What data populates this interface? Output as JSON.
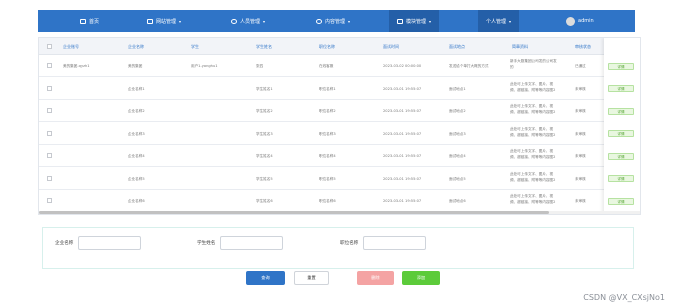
{
  "nav": {
    "home": "首页",
    "site_mgmt": "网站管理",
    "people_mgmt": "人员管理",
    "content_mgmt": "内容管理",
    "module_mgmt": "模块管理",
    "personal_mgmt": "个人管理",
    "user": "admin",
    "caret": "▾"
  },
  "table": {
    "headers": [
      "企业账号",
      "企业名称",
      "学生",
      "学生姓名",
      "职位名称",
      "面试时间",
      "面试地点",
      "简章资料",
      "审核状态",
      "操作"
    ],
    "rows": [
      {
        "account": "美的集团-qyzh1",
        "company": "美的集团",
        "student": "用户1-yonghu1",
        "name": "张四",
        "position": "在线客服",
        "time": "2023-03-02 00:00:00",
        "place": "发送给个单打大概的方式",
        "detail": "新手大厨集团公司发的公司发的",
        "status": "已通过",
        "op": "详情"
      },
      {
        "account": "",
        "company": "企业名称1",
        "student": "",
        "name": "学生姓名1",
        "position": "职位名称1",
        "time": "2023-03-01 19:55:07",
        "place": "面试地点1",
        "detail": "此处可上传文字、图片、视频、超链接、附等等内容图2",
        "status": "未审核",
        "op": "详情"
      },
      {
        "account": "",
        "company": "企业名称2",
        "student": "",
        "name": "学生姓名2",
        "position": "职位名称2",
        "time": "2023-03-01 19:55:07",
        "place": "面试地点2",
        "detail": "此处可上传文字、图片、视频、超链接、附等等内容图2",
        "status": "未审核",
        "op": "详情"
      },
      {
        "account": "",
        "company": "企业名称3",
        "student": "",
        "name": "学生姓名3",
        "position": "职位名称3",
        "time": "2023-03-01 19:55:07",
        "place": "面试地点3",
        "detail": "此处可上传文字、图片、视频、超链接、附等等内容图2",
        "status": "未审核",
        "op": "详情"
      },
      {
        "account": "",
        "company": "企业名称4",
        "student": "",
        "name": "学生姓名4",
        "position": "职位名称4",
        "time": "2023-03-01 19:55:07",
        "place": "面试地点4",
        "detail": "此处可上传文字、图片、视频、超链接、附等等内容图2",
        "status": "未审核",
        "op": "详情"
      },
      {
        "account": "",
        "company": "企业名称5",
        "student": "",
        "name": "学生姓名5",
        "position": "职位名称5",
        "time": "2023-03-01 19:55:07",
        "place": "面试地点5",
        "detail": "此处可上传文字、图片、视频、超链接、附等等内容图2",
        "status": "未审核",
        "op": "详情"
      },
      {
        "account": "",
        "company": "企业名称6",
        "student": "",
        "name": "学生姓名6",
        "position": "职位名称6",
        "time": "2023-03-01 19:55:07",
        "place": "面试地点6",
        "detail": "此处可上传文字、图片、视频、超链接、附等等内容图2",
        "status": "未审核",
        "op": "详情"
      }
    ]
  },
  "search": {
    "company_label": "企业名称",
    "student_label": "学生姓名",
    "position_label": "职位名称",
    "company_value": "",
    "student_value": "",
    "position_value": ""
  },
  "buttons": {
    "query": "查询",
    "reset": "重置",
    "delete": "删除",
    "add": "添加"
  },
  "watermark": "CSDN @VX_CXsjNo1",
  "colors": {
    "nav_bg": "#2f74c7",
    "header_text": "#2f74c7",
    "delete": "#f4a3a3",
    "add": "#5ccb3a",
    "detail_btn": "#e9f7e0"
  }
}
